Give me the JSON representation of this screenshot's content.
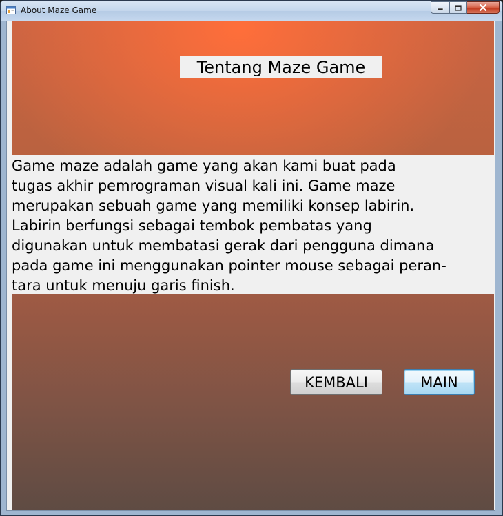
{
  "window": {
    "title": "About Maze Game"
  },
  "caption_buttons": {
    "minimize_icon": "minimize-icon",
    "maximize_icon": "maximize-icon",
    "close_icon": "close-icon"
  },
  "content": {
    "heading": "Tentang Maze Game",
    "description_lines": [
      "Game maze adalah game yang akan kami buat pada",
      "tugas akhir pemrograman visual kali ini. Game maze",
      "merupakan sebuah game yang memiliki konsep labirin.",
      "Labirin berfungsi sebagai tembok pembatas yang",
      "digunakan untuk membatasi gerak dari pengguna dimana",
      "pada game ini menggunakan pointer mouse sebagai peran-",
      "tara untuk menuju garis finish."
    ]
  },
  "buttons": {
    "back_label": "KEMBALI",
    "play_label": "MAIN"
  },
  "colors": {
    "panel_top": "#ff6e3a",
    "panel_bottom": "#5e4b43",
    "focused_button_border": "#3c7fb1"
  }
}
